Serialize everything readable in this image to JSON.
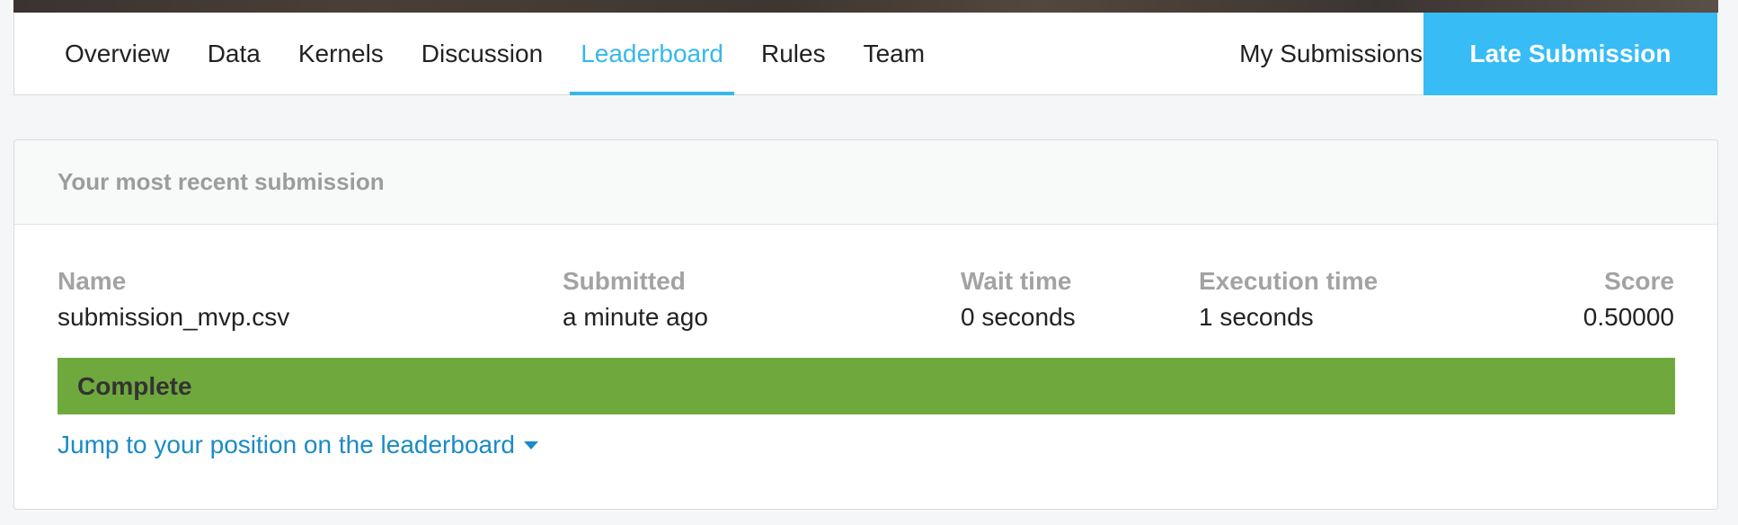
{
  "nav": {
    "tabs": [
      {
        "label": "Overview"
      },
      {
        "label": "Data"
      },
      {
        "label": "Kernels"
      },
      {
        "label": "Discussion"
      },
      {
        "label": "Leaderboard",
        "active": true
      },
      {
        "label": "Rules"
      },
      {
        "label": "Team"
      }
    ],
    "my_submissions_label": "My Submissions",
    "late_submission_label": "Late Submission"
  },
  "submission": {
    "header_title": "Your most recent submission",
    "columns": {
      "name": {
        "label": "Name",
        "value": "submission_mvp.csv"
      },
      "submitted": {
        "label": "Submitted",
        "value": "a minute ago"
      },
      "wait_time": {
        "label": "Wait time",
        "value": "0 seconds"
      },
      "execution_time": {
        "label": "Execution time",
        "value": "1 seconds"
      },
      "score": {
        "label": "Score",
        "value": "0.50000"
      }
    },
    "status": "Complete",
    "jump_link_label": "Jump to your position on the leaderboard"
  },
  "colors": {
    "accent": "#37b8eb",
    "late_button_bg": "#37bcf5",
    "status_complete": "#6fa93d",
    "link": "#1a8bc6"
  },
  "icons": {
    "jump_link_caret": "caret-down-icon"
  }
}
